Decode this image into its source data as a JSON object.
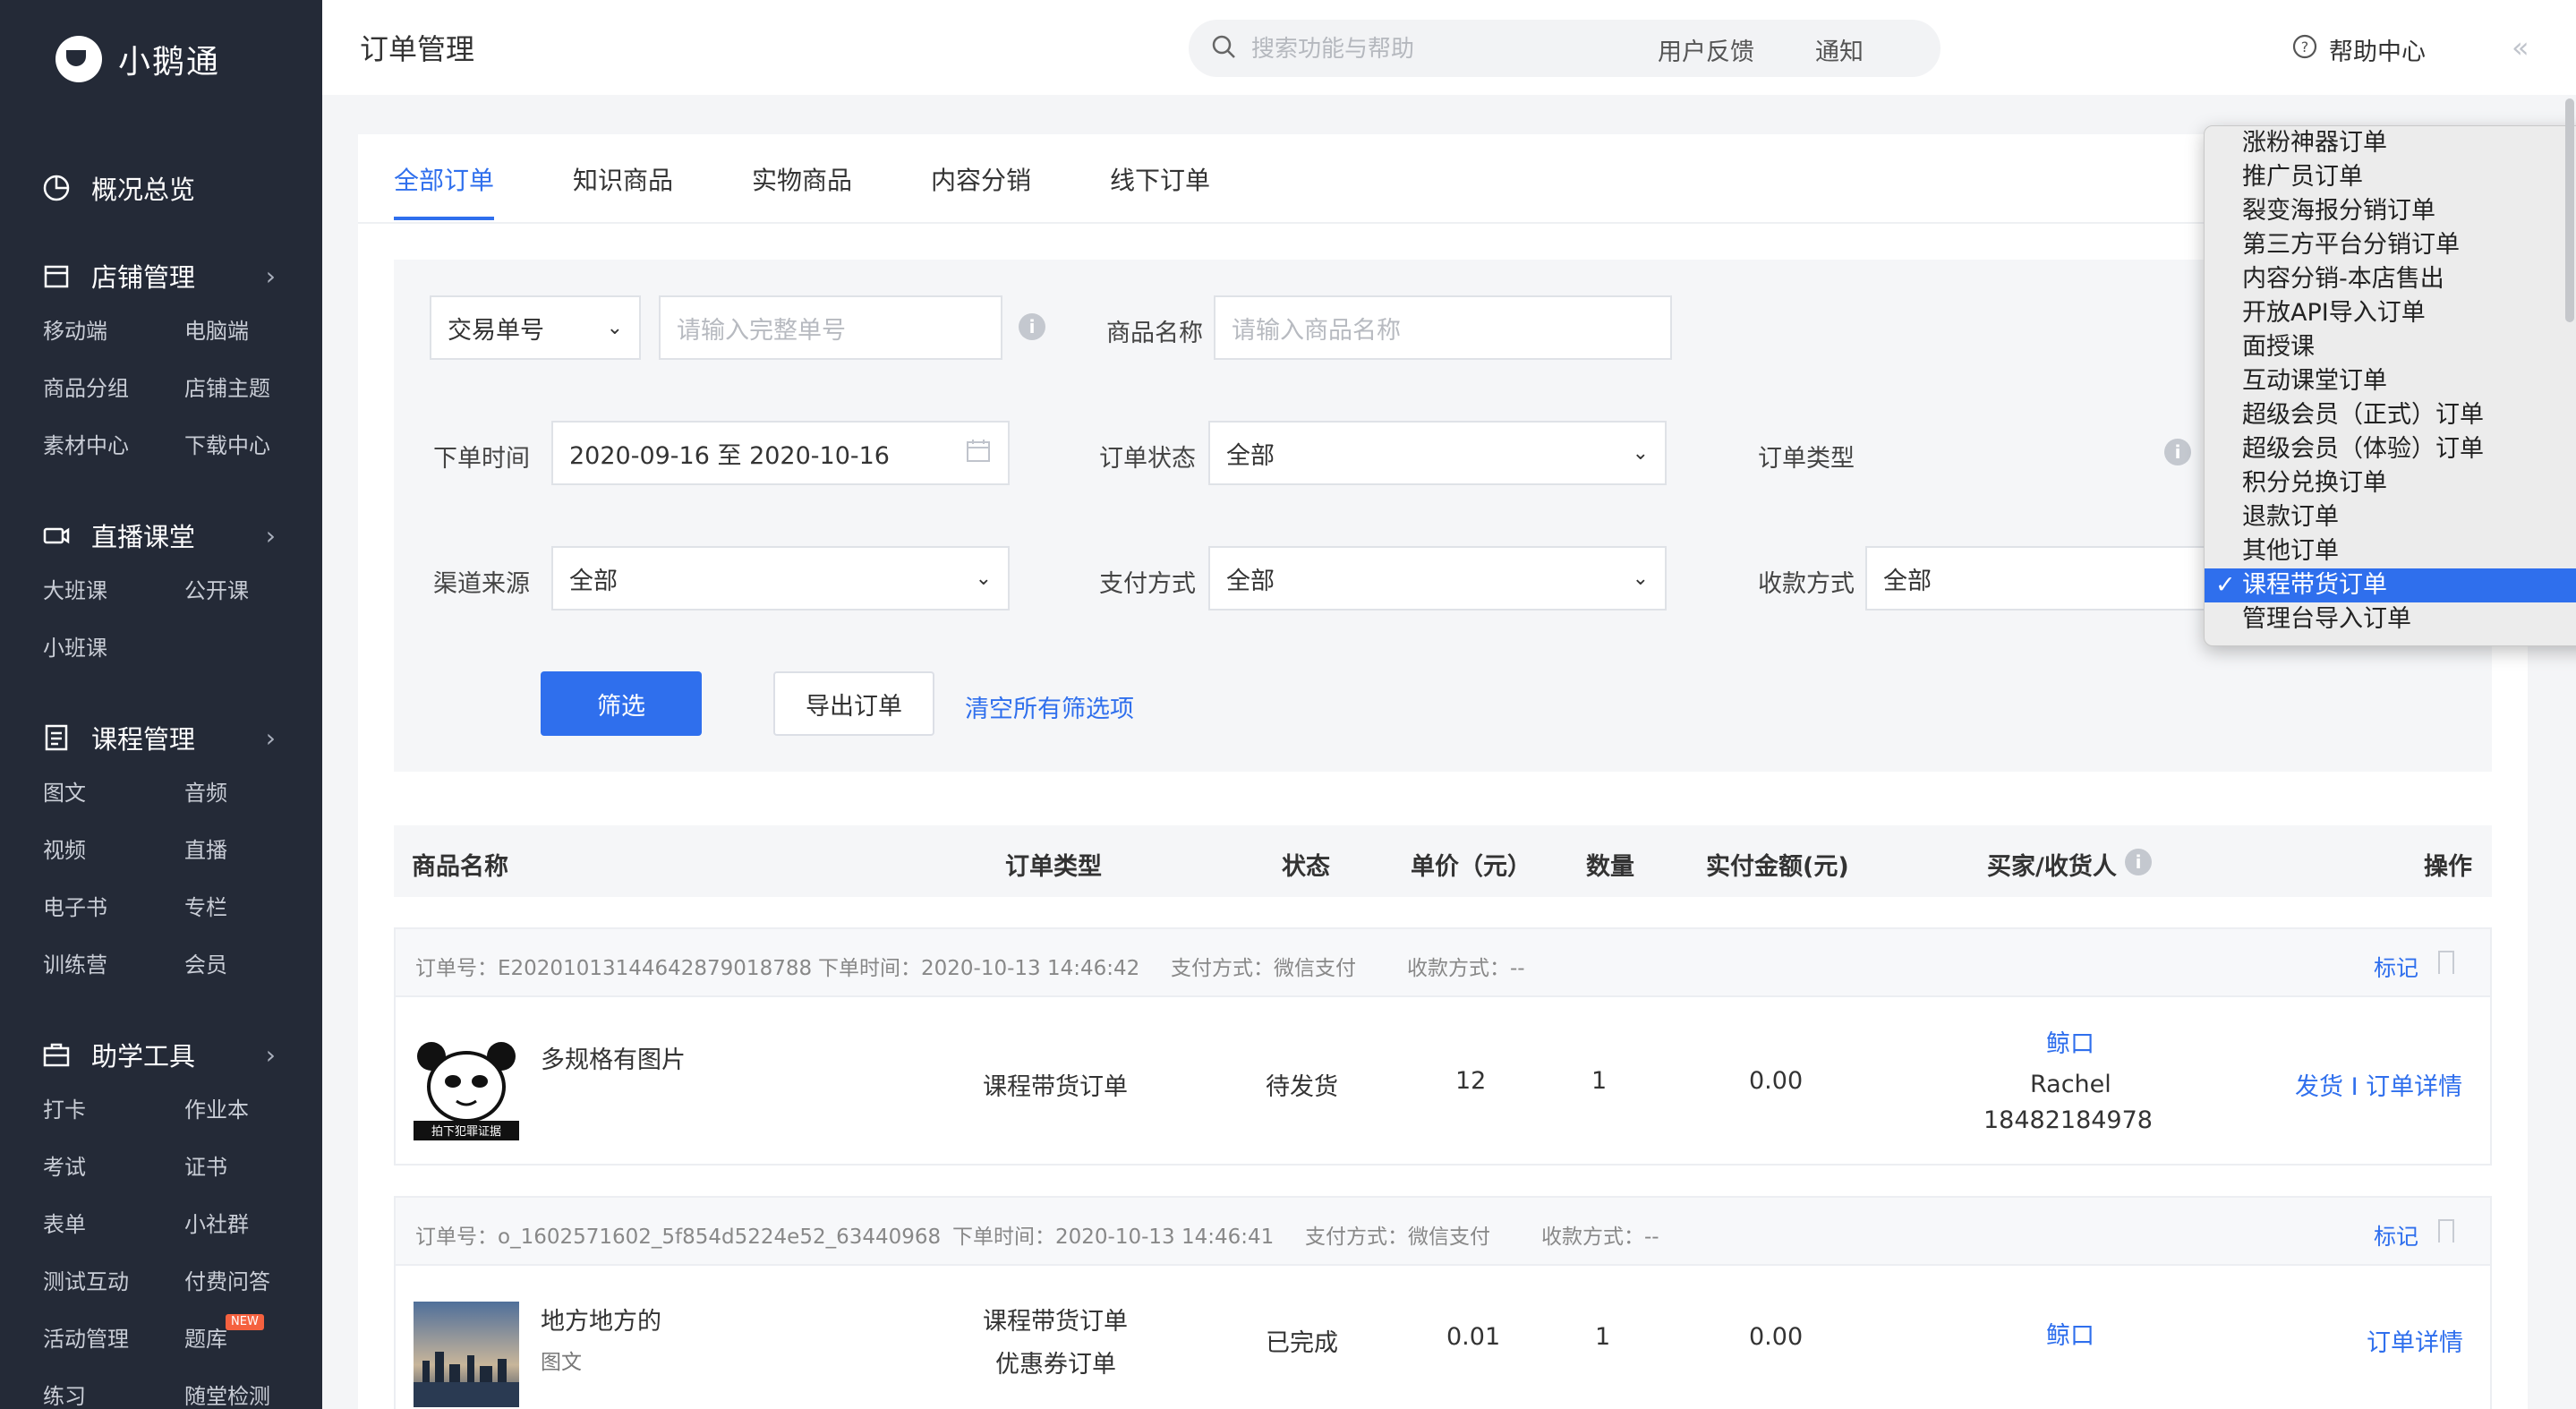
{
  "app": {
    "logo_text": "小鹅通"
  },
  "sidebar": {
    "groups": [
      {
        "label": "概况总览",
        "items": []
      },
      {
        "label": "店铺管理",
        "items": [
          "移动端",
          "电脑端",
          "商品分组",
          "店铺主题",
          "素材中心",
          "下载中心"
        ]
      },
      {
        "label": "直播课堂",
        "items": [
          "大班课",
          "公开课",
          "小班课"
        ]
      },
      {
        "label": "课程管理",
        "items": [
          "图文",
          "音频",
          "视频",
          "直播",
          "电子书",
          "专栏",
          "训练营",
          "会员"
        ]
      },
      {
        "label": "助学工具",
        "items": [
          "打卡",
          "作业本",
          "考试",
          "证书",
          "表单",
          "小社群",
          "测试互动",
          "付费问答",
          "活动管理",
          "题库",
          "练习",
          "随堂检测"
        ]
      }
    ],
    "new_badge": "NEW"
  },
  "header": {
    "title": "订单管理",
    "search_placeholder": "搜索功能与帮助",
    "links": [
      "用户反馈",
      "通知"
    ],
    "help": "帮助中心",
    "collapse": "«"
  },
  "tabs": [
    "全部订单",
    "知识商品",
    "实物商品",
    "内容分销",
    "线下订单"
  ],
  "filters": {
    "trade_no_select": "交易单号",
    "trade_no_placeholder": "请输入完整单号",
    "product_label": "商品名称",
    "product_placeholder": "请输入商品名称",
    "time_label": "下单时间",
    "time_value": "2020-09-16 至 2020-10-16",
    "status_label": "订单状态",
    "status_value": "全部",
    "type_label": "订单类型",
    "channel_label": "渠道来源",
    "channel_value": "全部",
    "pay_label": "支付方式",
    "pay_value": "全部",
    "collect_label": "收款方式",
    "collect_value": "全部",
    "filter_button": "筛选",
    "export_button": "导出订单",
    "clear_link": "清空所有筛选项"
  },
  "table": {
    "headers": [
      "商品名称",
      "订单类型",
      "状态",
      "单价（元）",
      "数量",
      "实付金额(元)",
      "买家/收货人",
      "操作"
    ],
    "orders": [
      {
        "order_no": "订单号：E20201013144642879018788",
        "time": "下单时间：2020-10-13 14:46:42",
        "pay": "支付方式：微信支付",
        "collect": "收款方式：--",
        "mark": "标记",
        "product": "多规格有图片",
        "product_sub": "",
        "thumb_caption": "拍下犯罪证据",
        "type": "课程带货订单",
        "type2": "",
        "status": "待发货",
        "price": "12",
        "qty": "1",
        "paid": "0.00",
        "buyer": "鲸口",
        "receiver": "Rachel",
        "phone": "18482184978",
        "action": "发货 I 订单详情"
      },
      {
        "order_no": "订单号：o_1602571602_5f854d5224e52_63440968",
        "time": "下单时间：2020-10-13 14:46:41",
        "pay": "支付方式：微信支付",
        "collect": "收款方式：--",
        "mark": "标记",
        "product": "地方地方的",
        "product_sub": "图文",
        "type": "课程带货订单",
        "type2": "优惠券订单",
        "status": "已完成",
        "price": "0.01",
        "qty": "1",
        "paid": "0.00",
        "buyer": "鲸口",
        "action": "订单详情"
      }
    ]
  },
  "dropdown": {
    "options": [
      "涨粉神器订单",
      "推广员订单",
      "裂变海报分销订单",
      "第三方平台分销订单",
      "内容分销-本店售出",
      "开放API导入订单",
      "面授课",
      "互动课堂订单",
      "超级会员（正式）订单",
      "超级会员（体验）订单",
      "积分兑换订单",
      "退款订单",
      "其他订单",
      "课程带货订单",
      "管理台导入订单"
    ],
    "selected_index": 13,
    "check": "✓"
  },
  "colors": {
    "accent": "#2f6fed",
    "sidebar_bg": "#242a37",
    "badge": "#f5613f"
  }
}
